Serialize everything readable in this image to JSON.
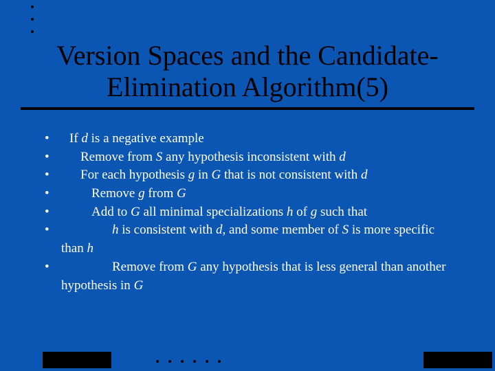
{
  "title": {
    "line1": "Version Spaces and the Candidate-",
    "line2": "Elimination Algorithm(5)"
  },
  "bullets": [
    {
      "indent": 0,
      "segments": [
        {
          "t": "If ",
          "i": false
        },
        {
          "t": "d",
          "i": true
        },
        {
          "t": " is a negative example",
          "i": false
        }
      ]
    },
    {
      "indent": 1,
      "segments": [
        {
          "t": "Remove from ",
          "i": false
        },
        {
          "t": "S",
          "i": true
        },
        {
          "t": " any hypothesis inconsistent with ",
          "i": false
        },
        {
          "t": "d",
          "i": true
        }
      ]
    },
    {
      "indent": 1,
      "segments": [
        {
          "t": "For each hypothesis ",
          "i": false
        },
        {
          "t": "g",
          "i": true
        },
        {
          "t": " in ",
          "i": false
        },
        {
          "t": "G",
          "i": true
        },
        {
          "t": " that is not consistent with ",
          "i": false
        },
        {
          "t": "d",
          "i": true
        }
      ]
    },
    {
      "indent": 2,
      "segments": [
        {
          "t": "Remove ",
          "i": false
        },
        {
          "t": "g",
          "i": true
        },
        {
          "t": " from ",
          "i": false
        },
        {
          "t": "G",
          "i": true
        }
      ]
    },
    {
      "indent": 2,
      "segments": [
        {
          "t": "Add to ",
          "i": false
        },
        {
          "t": "G",
          "i": true
        },
        {
          "t": " all minimal specializations ",
          "i": false
        },
        {
          "t": "h",
          "i": true
        },
        {
          "t": " of ",
          "i": false
        },
        {
          "t": "g",
          "i": true
        },
        {
          "t": " such that",
          "i": false
        }
      ]
    },
    {
      "indent": 3,
      "segments": [
        {
          "t": "h",
          "i": true
        },
        {
          "t": " is consistent with ",
          "i": false
        },
        {
          "t": "d",
          "i": true
        },
        {
          "t": ", and some member of ",
          "i": false
        },
        {
          "t": "S",
          "i": true
        },
        {
          "t": " is more specific",
          "i": false
        }
      ],
      "continuation": [
        {
          "t": "than ",
          "i": false
        },
        {
          "t": "h",
          "i": true
        }
      ]
    },
    {
      "indent": 3,
      "segments": [
        {
          "t": "Remove from ",
          "i": false
        },
        {
          "t": "G",
          "i": true
        },
        {
          "t": " any hypothesis that is less general than another",
          "i": false
        }
      ],
      "continuation": [
        {
          "t": "hypothesis in ",
          "i": false
        },
        {
          "t": "G",
          "i": true
        }
      ]
    }
  ]
}
